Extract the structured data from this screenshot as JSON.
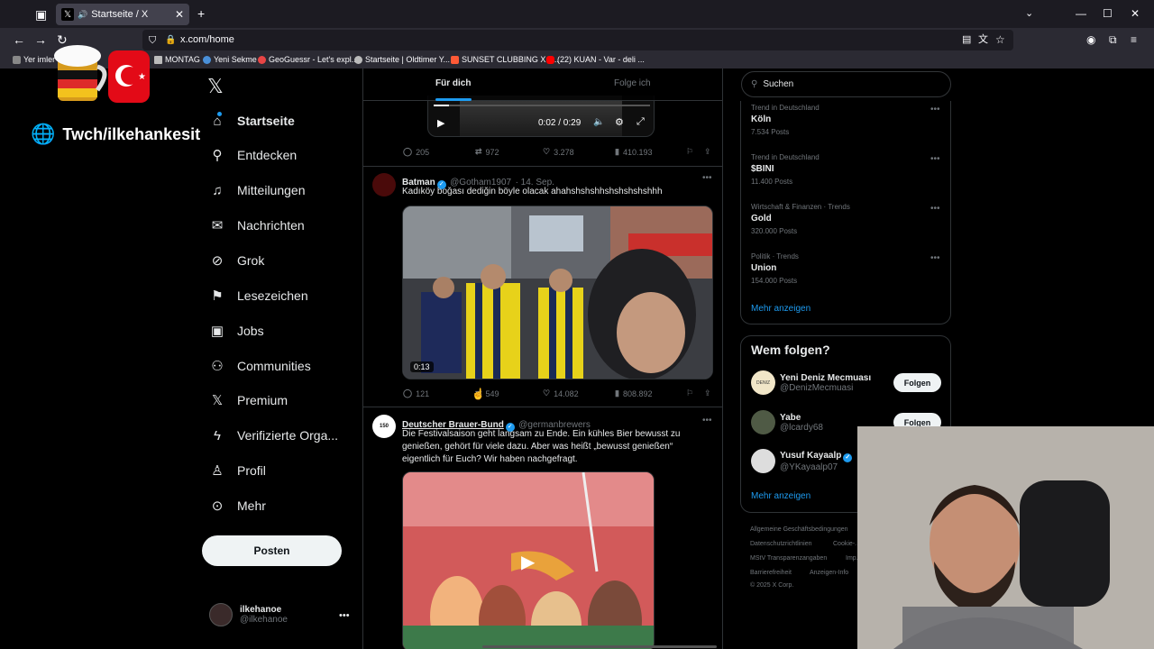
{
  "browser": {
    "tab_title": "Startseite / X",
    "url": "x.com/home",
    "bookmarks": [
      "Yer imler",
      "MONTAG",
      "Yeni Sekme",
      "GeoGuessr - Let's expl...",
      "Startseite | Oldtimer Y...",
      "SUNSET CLUBBING X J...",
      "(22) KUAN - Var - deli ..."
    ]
  },
  "overlay": {
    "channel": "Twch/ilkehankesit"
  },
  "nav": {
    "items": [
      {
        "label": "Startseite",
        "icon": "home-icon"
      },
      {
        "label": "Entdecken",
        "icon": "search-icon"
      },
      {
        "label": "Mitteilungen",
        "icon": "bell-icon"
      },
      {
        "label": "Nachrichten",
        "icon": "mail-icon"
      },
      {
        "label": "Grok",
        "icon": "grok-icon"
      },
      {
        "label": "Lesezeichen",
        "icon": "bookmark-icon"
      },
      {
        "label": "Jobs",
        "icon": "briefcase-icon"
      },
      {
        "label": "Communities",
        "icon": "people-icon"
      },
      {
        "label": "Premium",
        "icon": "x-icon"
      },
      {
        "label": "Verifizierte Orga...",
        "icon": "lightning-icon"
      },
      {
        "label": "Profil",
        "icon": "person-icon"
      },
      {
        "label": "Mehr",
        "icon": "more-circle-icon"
      }
    ],
    "post_button": "Posten",
    "profile": {
      "name": "ilkehanoe",
      "handle": "@ilkehanoe"
    }
  },
  "feed": {
    "tabs": [
      "Für dich",
      "Folge ich"
    ],
    "tweet0": {
      "player_time": "0:02 / 0:29",
      "stats": {
        "replies": "205",
        "reposts": "972",
        "likes": "3.278",
        "views": "410.193"
      }
    },
    "tweet1": {
      "name": "Batman",
      "handle": "@Gotham1907",
      "date": "· 14. Sep.",
      "text": "Kadıköy boğası dediğin böyle olacak ahahshshshhshshshshshhh",
      "video_duration": "0:13",
      "stats": {
        "replies": "121",
        "reposts": "549",
        "likes": "14.082",
        "views": "808.892"
      }
    },
    "tweet2": {
      "name": "Deutscher Brauer-Bund",
      "handle": "@germanbrewers",
      "text": "Die Festivalsaison geht langsam zu Ende. Ein kühles Bier bewusst zu genießen, gehört für viele dazu. Aber was heißt „bewusst genießen“ eigentlich für Euch? Wir haben nachgefragt."
    }
  },
  "sidebar": {
    "search_placeholder": "Suchen",
    "trends": [
      {
        "category": "Trend in Deutschland",
        "title": "Köln",
        "posts": "7.534 Posts"
      },
      {
        "category": "Trend in Deutschland",
        "title": "$BINI",
        "posts": "11.400 Posts"
      },
      {
        "category": "Wirtschaft & Finanzen · Trends",
        "title": "Gold",
        "posts": "320.000 Posts"
      },
      {
        "category": "Politik · Trends",
        "title": "Union",
        "posts": "154.000 Posts"
      }
    ],
    "trends_more": "Mehr anzeigen",
    "who_to_follow": {
      "title": "Wem folgen?",
      "users": [
        {
          "name": "Yeni Deniz Mecmuası",
          "handle": "@DenizMecmuasi",
          "button": "Folgen"
        },
        {
          "name": "Yabe",
          "handle": "@lcardy68",
          "button": "Folgen"
        },
        {
          "name": "Yusuf Kayaalp",
          "handle": "@YKayaalp07",
          "button": ""
        }
      ],
      "more": "Mehr anzeigen"
    },
    "footer": {
      "links": [
        "Allgemeine Geschäftsbedingungen",
        "Datenschutzrichtlinien",
        "Cookie-...",
        "MStV Transparenzangaben",
        "Imp...",
        "Barrierefreiheit",
        "Anzeigen-Info"
      ],
      "copyright": "© 2025 X Corp."
    }
  }
}
